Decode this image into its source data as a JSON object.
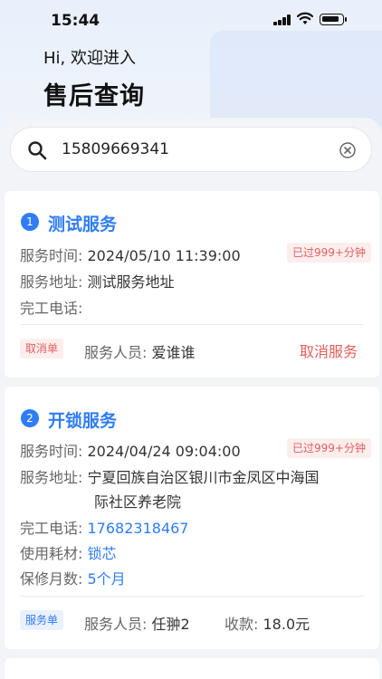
{
  "status_bar": {
    "time": "15:44"
  },
  "header": {
    "greeting": "Hi, 欢迎进入",
    "title": "售后查询"
  },
  "search": {
    "value": "15809669341"
  },
  "orders": [
    {
      "index": "1",
      "title": "测试服务",
      "time_label": "服务时间:",
      "time_value": "2024/05/10 11:39:00",
      "overdue_badge": "已过999+分钟",
      "address_label": "服务地址:",
      "address_value": "测试服务地址",
      "phone_label": "完工电话:",
      "phone_value": "",
      "type_tag": "取消单",
      "staff_label": "服务人员:",
      "staff_value": "爱谁谁",
      "action_label": "取消服务"
    },
    {
      "index": "2",
      "title": "开锁服务",
      "time_label": "服务时间:",
      "time_value": "2024/04/24 09:04:00",
      "overdue_badge": "已过999+分钟",
      "address_label": "服务地址:",
      "address_line1": "宁夏回族自治区银川市金凤区中海国",
      "address_line2": "际社区养老院",
      "phone_label": "完工电话:",
      "phone_value": "17682318467",
      "material_label": "使用耗材:",
      "material_value": "锁芯",
      "warranty_label": "保修月数:",
      "warranty_value": "5个月",
      "type_tag": "服务单",
      "staff_label": "服务人员:",
      "staff_value": "任翀2",
      "fee_label": "收款:",
      "fee_value": "18.0元"
    }
  ],
  "colors": {
    "accent": "#2f7cf6",
    "danger": "#e0605a",
    "badge_bg": "#fdeeee"
  }
}
